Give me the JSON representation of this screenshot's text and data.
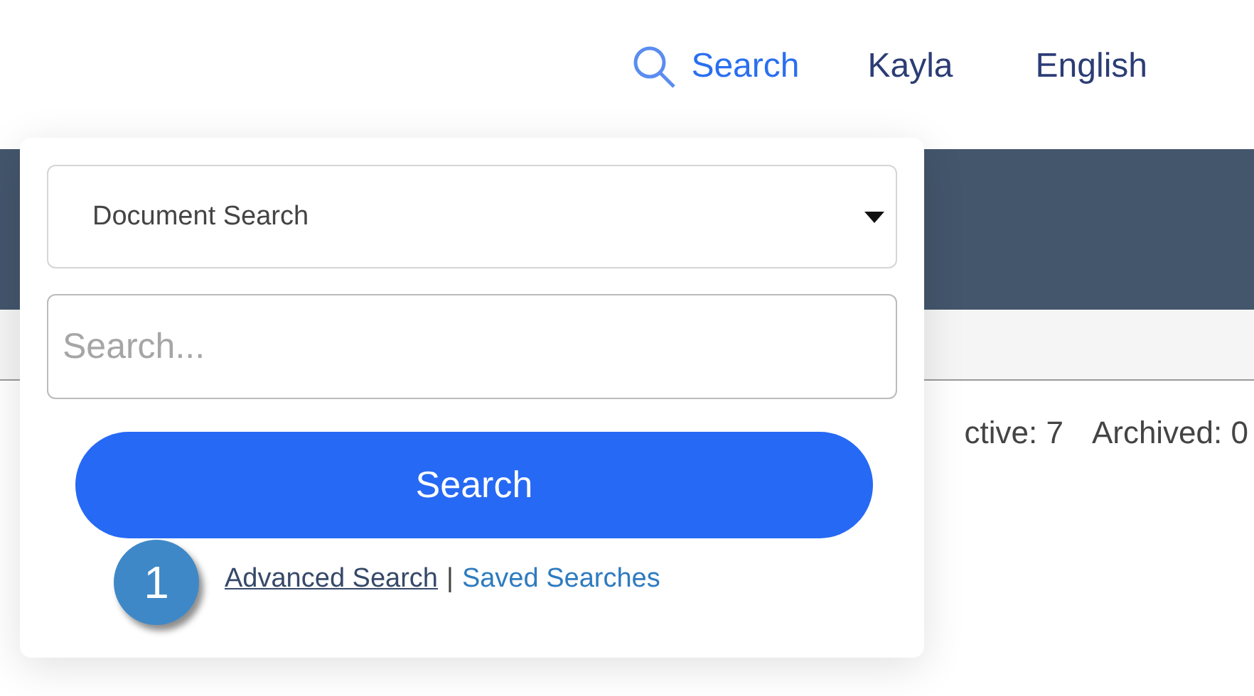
{
  "nav": {
    "search_link": "Search",
    "user": "Kayla",
    "language": "English"
  },
  "counts": [
    {
      "label": "ctive: 7"
    },
    {
      "label": "Archived: 0"
    }
  ],
  "search_popup": {
    "search_type": "Document Search",
    "query": {
      "placeholder": "Search..."
    },
    "submit": "Search",
    "links": [
      {
        "label": "Advanced Search",
        "underlined": true
      },
      {
        "label": "Saved Searches",
        "underlined": false
      }
    ],
    "separator": "|"
  },
  "callout": {
    "number": "1"
  }
}
